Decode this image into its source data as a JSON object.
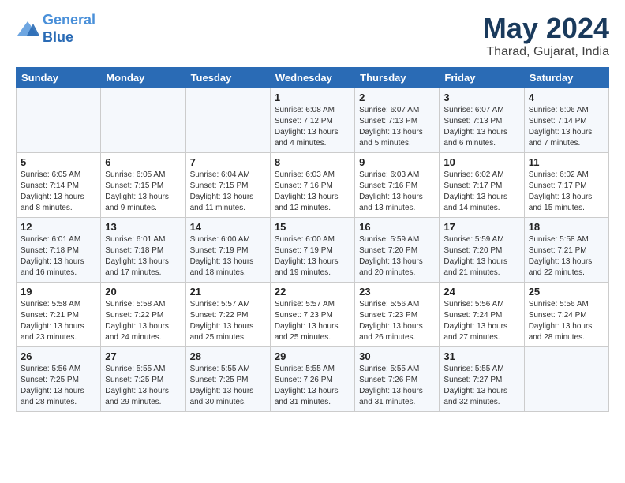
{
  "header": {
    "logo_line1": "General",
    "logo_line2": "Blue",
    "month_year": "May 2024",
    "location": "Tharad, Gujarat, India"
  },
  "weekdays": [
    "Sunday",
    "Monday",
    "Tuesday",
    "Wednesday",
    "Thursday",
    "Friday",
    "Saturday"
  ],
  "weeks": [
    [
      {
        "day": "",
        "sunrise": "",
        "sunset": "",
        "daylight": ""
      },
      {
        "day": "",
        "sunrise": "",
        "sunset": "",
        "daylight": ""
      },
      {
        "day": "",
        "sunrise": "",
        "sunset": "",
        "daylight": ""
      },
      {
        "day": "1",
        "sunrise": "Sunrise: 6:08 AM",
        "sunset": "Sunset: 7:12 PM",
        "daylight": "Daylight: 13 hours and 4 minutes."
      },
      {
        "day": "2",
        "sunrise": "Sunrise: 6:07 AM",
        "sunset": "Sunset: 7:13 PM",
        "daylight": "Daylight: 13 hours and 5 minutes."
      },
      {
        "day": "3",
        "sunrise": "Sunrise: 6:07 AM",
        "sunset": "Sunset: 7:13 PM",
        "daylight": "Daylight: 13 hours and 6 minutes."
      },
      {
        "day": "4",
        "sunrise": "Sunrise: 6:06 AM",
        "sunset": "Sunset: 7:14 PM",
        "daylight": "Daylight: 13 hours and 7 minutes."
      }
    ],
    [
      {
        "day": "5",
        "sunrise": "Sunrise: 6:05 AM",
        "sunset": "Sunset: 7:14 PM",
        "daylight": "Daylight: 13 hours and 8 minutes."
      },
      {
        "day": "6",
        "sunrise": "Sunrise: 6:05 AM",
        "sunset": "Sunset: 7:15 PM",
        "daylight": "Daylight: 13 hours and 9 minutes."
      },
      {
        "day": "7",
        "sunrise": "Sunrise: 6:04 AM",
        "sunset": "Sunset: 7:15 PM",
        "daylight": "Daylight: 13 hours and 11 minutes."
      },
      {
        "day": "8",
        "sunrise": "Sunrise: 6:03 AM",
        "sunset": "Sunset: 7:16 PM",
        "daylight": "Daylight: 13 hours and 12 minutes."
      },
      {
        "day": "9",
        "sunrise": "Sunrise: 6:03 AM",
        "sunset": "Sunset: 7:16 PM",
        "daylight": "Daylight: 13 hours and 13 minutes."
      },
      {
        "day": "10",
        "sunrise": "Sunrise: 6:02 AM",
        "sunset": "Sunset: 7:17 PM",
        "daylight": "Daylight: 13 hours and 14 minutes."
      },
      {
        "day": "11",
        "sunrise": "Sunrise: 6:02 AM",
        "sunset": "Sunset: 7:17 PM",
        "daylight": "Daylight: 13 hours and 15 minutes."
      }
    ],
    [
      {
        "day": "12",
        "sunrise": "Sunrise: 6:01 AM",
        "sunset": "Sunset: 7:18 PM",
        "daylight": "Daylight: 13 hours and 16 minutes."
      },
      {
        "day": "13",
        "sunrise": "Sunrise: 6:01 AM",
        "sunset": "Sunset: 7:18 PM",
        "daylight": "Daylight: 13 hours and 17 minutes."
      },
      {
        "day": "14",
        "sunrise": "Sunrise: 6:00 AM",
        "sunset": "Sunset: 7:19 PM",
        "daylight": "Daylight: 13 hours and 18 minutes."
      },
      {
        "day": "15",
        "sunrise": "Sunrise: 6:00 AM",
        "sunset": "Sunset: 7:19 PM",
        "daylight": "Daylight: 13 hours and 19 minutes."
      },
      {
        "day": "16",
        "sunrise": "Sunrise: 5:59 AM",
        "sunset": "Sunset: 7:20 PM",
        "daylight": "Daylight: 13 hours and 20 minutes."
      },
      {
        "day": "17",
        "sunrise": "Sunrise: 5:59 AM",
        "sunset": "Sunset: 7:20 PM",
        "daylight": "Daylight: 13 hours and 21 minutes."
      },
      {
        "day": "18",
        "sunrise": "Sunrise: 5:58 AM",
        "sunset": "Sunset: 7:21 PM",
        "daylight": "Daylight: 13 hours and 22 minutes."
      }
    ],
    [
      {
        "day": "19",
        "sunrise": "Sunrise: 5:58 AM",
        "sunset": "Sunset: 7:21 PM",
        "daylight": "Daylight: 13 hours and 23 minutes."
      },
      {
        "day": "20",
        "sunrise": "Sunrise: 5:58 AM",
        "sunset": "Sunset: 7:22 PM",
        "daylight": "Daylight: 13 hours and 24 minutes."
      },
      {
        "day": "21",
        "sunrise": "Sunrise: 5:57 AM",
        "sunset": "Sunset: 7:22 PM",
        "daylight": "Daylight: 13 hours and 25 minutes."
      },
      {
        "day": "22",
        "sunrise": "Sunrise: 5:57 AM",
        "sunset": "Sunset: 7:23 PM",
        "daylight": "Daylight: 13 hours and 25 minutes."
      },
      {
        "day": "23",
        "sunrise": "Sunrise: 5:56 AM",
        "sunset": "Sunset: 7:23 PM",
        "daylight": "Daylight: 13 hours and 26 minutes."
      },
      {
        "day": "24",
        "sunrise": "Sunrise: 5:56 AM",
        "sunset": "Sunset: 7:24 PM",
        "daylight": "Daylight: 13 hours and 27 minutes."
      },
      {
        "day": "25",
        "sunrise": "Sunrise: 5:56 AM",
        "sunset": "Sunset: 7:24 PM",
        "daylight": "Daylight: 13 hours and 28 minutes."
      }
    ],
    [
      {
        "day": "26",
        "sunrise": "Sunrise: 5:56 AM",
        "sunset": "Sunset: 7:25 PM",
        "daylight": "Daylight: 13 hours and 28 minutes."
      },
      {
        "day": "27",
        "sunrise": "Sunrise: 5:55 AM",
        "sunset": "Sunset: 7:25 PM",
        "daylight": "Daylight: 13 hours and 29 minutes."
      },
      {
        "day": "28",
        "sunrise": "Sunrise: 5:55 AM",
        "sunset": "Sunset: 7:25 PM",
        "daylight": "Daylight: 13 hours and 30 minutes."
      },
      {
        "day": "29",
        "sunrise": "Sunrise: 5:55 AM",
        "sunset": "Sunset: 7:26 PM",
        "daylight": "Daylight: 13 hours and 31 minutes."
      },
      {
        "day": "30",
        "sunrise": "Sunrise: 5:55 AM",
        "sunset": "Sunset: 7:26 PM",
        "daylight": "Daylight: 13 hours and 31 minutes."
      },
      {
        "day": "31",
        "sunrise": "Sunrise: 5:55 AM",
        "sunset": "Sunset: 7:27 PM",
        "daylight": "Daylight: 13 hours and 32 minutes."
      },
      {
        "day": "",
        "sunrise": "",
        "sunset": "",
        "daylight": ""
      }
    ]
  ]
}
